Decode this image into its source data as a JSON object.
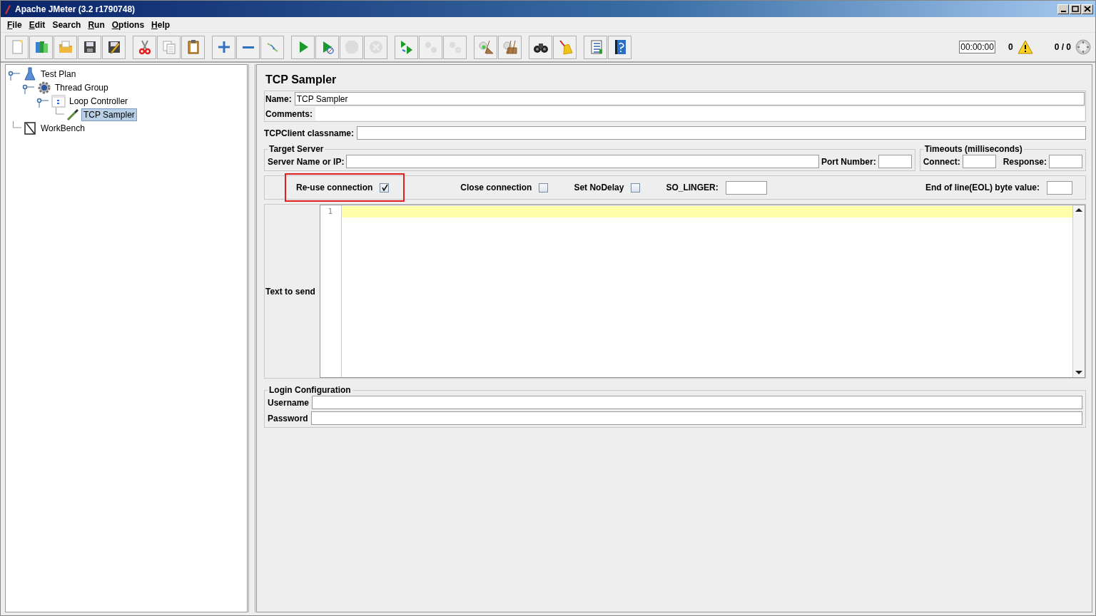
{
  "window": {
    "title": "Apache JMeter (3.2 r1790748)"
  },
  "menu": [
    {
      "label": "File",
      "underlined_first": true
    },
    {
      "label": "Edit",
      "underlined_first": true
    },
    {
      "label": "Search",
      "underlined_first": false
    },
    {
      "label": "Run",
      "underlined_first": true
    },
    {
      "label": "Options",
      "underlined_first": true
    },
    {
      "label": "Help",
      "underlined_first": true
    }
  ],
  "toolbar": {
    "groups": [
      [
        {
          "kind": "new",
          "disabled": false
        },
        {
          "kind": "templates",
          "disabled": false
        },
        {
          "kind": "open",
          "disabled": false
        },
        {
          "kind": "save",
          "disabled": false
        },
        {
          "kind": "save-as",
          "disabled": false
        }
      ],
      [
        {
          "kind": "cut",
          "disabled": false
        },
        {
          "kind": "copy",
          "disabled": false
        },
        {
          "kind": "paste",
          "disabled": false
        }
      ],
      [
        {
          "kind": "expand",
          "disabled": false
        },
        {
          "kind": "collapse",
          "disabled": false
        },
        {
          "kind": "toggle",
          "disabled": false
        }
      ],
      [
        {
          "kind": "start",
          "disabled": false
        },
        {
          "kind": "start-no-timers",
          "disabled": false
        },
        {
          "kind": "stop",
          "disabled": true
        },
        {
          "kind": "shutdown",
          "disabled": true
        }
      ],
      [
        {
          "kind": "remote-start",
          "disabled": false
        },
        {
          "kind": "remote-stop",
          "disabled": true
        },
        {
          "kind": "remote-shutdown",
          "disabled": true
        }
      ],
      [
        {
          "kind": "clear",
          "disabled": false
        },
        {
          "kind": "clear-all",
          "disabled": false
        }
      ],
      [
        {
          "kind": "search",
          "disabled": false
        },
        {
          "kind": "reset-search",
          "disabled": false
        }
      ],
      [
        {
          "kind": "function-helper",
          "disabled": false
        },
        {
          "kind": "help",
          "disabled": false
        }
      ]
    ],
    "timer": "00:00:00",
    "warnings": "0",
    "threads": "0 / 0"
  },
  "tree": [
    {
      "label": "Test Plan",
      "kind": "plan",
      "expanded": true,
      "selected": false,
      "children": [
        {
          "label": "Thread Group",
          "kind": "threads",
          "expanded": true,
          "selected": false,
          "children": [
            {
              "label": "Loop Controller",
              "kind": "controller",
              "expanded": true,
              "selected": false,
              "children": [
                {
                  "label": "TCP Sampler",
                  "kind": "sampler",
                  "selected": true
                }
              ]
            }
          ]
        }
      ]
    },
    {
      "label": "WorkBench",
      "kind": "workbench",
      "selected": false
    }
  ],
  "editor": {
    "title": "TCP Sampler",
    "name": {
      "label": "Name:",
      "value": "TCP Sampler"
    },
    "comments": {
      "label": "Comments:"
    },
    "classname": {
      "label": "TCPClient classname:"
    },
    "target_server": {
      "legend": "Target Server",
      "server": {
        "label": "Server Name or IP:"
      },
      "port": {
        "label": "Port Number:"
      }
    },
    "timeouts": {
      "legend": "Timeouts (milliseconds)",
      "connect": {
        "label": "Connect:"
      },
      "response": {
        "label": "Response:"
      }
    },
    "options": [
      {
        "kind": "checkbox",
        "label": "Re-use connection",
        "checked": true,
        "highlighted": true
      },
      {
        "kind": "checkbox",
        "label": "Close connection",
        "checked": false,
        "highlighted": false
      },
      {
        "kind": "checkbox",
        "label": "Set NoDelay",
        "checked": false,
        "highlighted": false
      },
      {
        "kind": "field",
        "label": "SO_LINGER:",
        "highlighted": false
      },
      {
        "kind": "field",
        "label": "End of line(EOL) byte value:",
        "highlighted": false
      }
    ],
    "text_to_send": {
      "label": "Text to send",
      "line_numbers": [
        "1"
      ]
    },
    "login": {
      "legend": "Login Configuration",
      "username": {
        "label": "Username"
      },
      "password": {
        "label": "Password"
      }
    }
  }
}
